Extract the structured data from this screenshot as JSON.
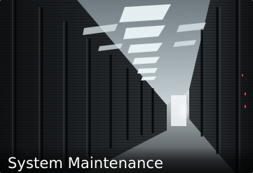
{
  "tile": {
    "caption": "System Maintenance",
    "image_subject": "server-room-corridor-photo"
  },
  "colors": {
    "caption_text": "#ffffff",
    "ceiling_light": "#e8f2f6",
    "rack_dark": "#1a1d20",
    "floor": "#8c9296"
  }
}
